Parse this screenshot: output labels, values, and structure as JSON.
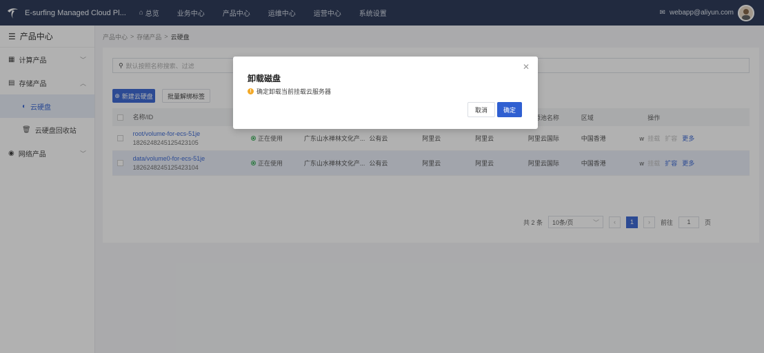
{
  "topbar": {
    "app_title": "E-surfing Managed Cloud Pl...",
    "nav": [
      "总览",
      "业务中心",
      "产品中心",
      "运维中心",
      "运营中心",
      "系统设置"
    ],
    "user_email": "webapp@aliyun.com"
  },
  "sidebar": {
    "header": "产品中心",
    "groups": [
      {
        "label": "计算产品"
      },
      {
        "label": "存储产品"
      },
      {
        "label": "网络产品"
      }
    ],
    "subs": [
      {
        "label": "云硬盘"
      },
      {
        "label": "云硬盘回收站"
      }
    ]
  },
  "breadcrumb": [
    "产品中心",
    "存储产品",
    "云硬盘"
  ],
  "search": {
    "placeholder": "默认按照名称搜索、过滤"
  },
  "buttons": {
    "create": "新建云硬盘",
    "batch_tag": "批量解绑标签"
  },
  "table": {
    "headers": {
      "name": "名称/ID",
      "resource_pool": "资源池名称",
      "region": "区域",
      "ops": "操作"
    },
    "rows": [
      {
        "name": "root/volume-for-ecs-51je",
        "id": "1826248245125423105",
        "status": "正在使用",
        "org": "广东山水禅林文化产...",
        "type": "公有云",
        "src": "阿里云",
        "prov": "阿里云",
        "pool": "阿里云国际",
        "region": "中国香港",
        "x": "w",
        "op1": "挂载",
        "op2": "扩容",
        "op3": "更多"
      },
      {
        "name": "data/volume0-for-ecs-51je",
        "id": "1826248245125423104",
        "status": "正在使用",
        "org": "广东山水禅林文化产...",
        "type": "公有云",
        "src": "阿里云",
        "prov": "阿里云",
        "pool": "阿里云国际",
        "region": "中国香港",
        "x": "w",
        "op1": "挂载",
        "op2": "扩容",
        "op3": "更多"
      }
    ]
  },
  "pager": {
    "total": "共 2 条",
    "size": "10条/页",
    "page": "1",
    "goto": "前往",
    "goto_value": "1",
    "unit": "页"
  },
  "modal": {
    "title": "卸载磁盘",
    "message": "确定卸载当前挂载云服务器",
    "cancel": "取消",
    "ok": "确定"
  }
}
